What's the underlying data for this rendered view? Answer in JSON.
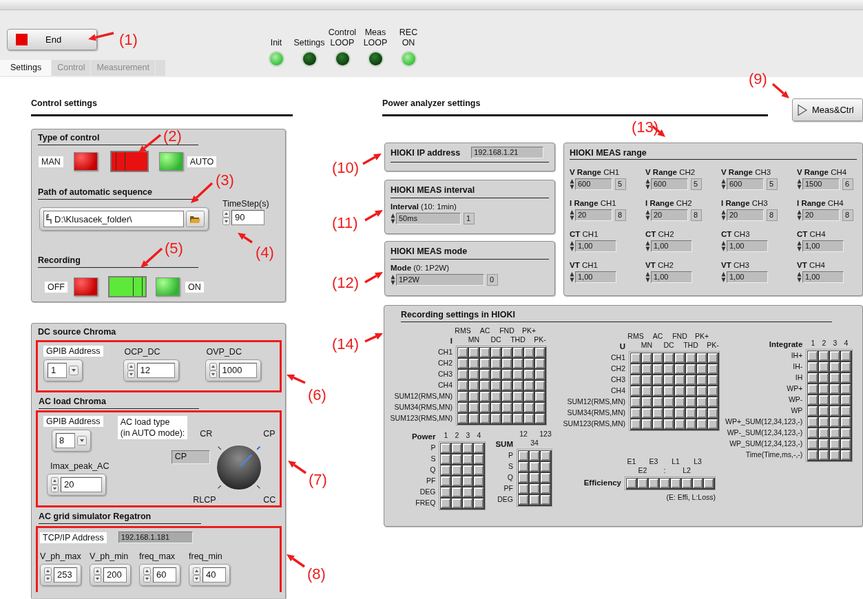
{
  "toolbar": {
    "end_button": "End",
    "leds": [
      {
        "label": "Init",
        "on": true
      },
      {
        "label": "Settings",
        "on": false
      },
      {
        "label": "Control LOOP",
        "on": false
      },
      {
        "label": "Meas LOOP",
        "on": false
      },
      {
        "label": "REC ON",
        "on": true
      }
    ]
  },
  "tabs": [
    {
      "label": "Settings",
      "selected": true
    },
    {
      "label": "Control",
      "selected": false
    },
    {
      "label": "Measurement",
      "selected": false
    }
  ],
  "control_settings": {
    "title": "Control settings",
    "type_of_control": {
      "title": "Type of control",
      "left_label": "MAN",
      "right_label": "AUTO",
      "auto": false
    },
    "path": {
      "title": "Path of automatic sequence",
      "value": "D:\\Klusacek_folder\\"
    },
    "timestep": {
      "label": "TimeStep(s)",
      "value": "90"
    },
    "recording": {
      "title": "Recording",
      "left_label": "OFF",
      "right_label": "ON",
      "on": true
    }
  },
  "dc_source": {
    "title": "DC source Chroma",
    "gpib": {
      "label": "GPIB Address",
      "value": "1"
    },
    "ocp": {
      "label": "OCP_DC",
      "value": "12"
    },
    "ovp": {
      "label": "OVP_DC",
      "value": "1000"
    }
  },
  "ac_load": {
    "title": "AC load Chroma",
    "gpib": {
      "label": "GPIB Address",
      "value": "8"
    },
    "imax": {
      "label": "Imax_peak_AC",
      "value": "20"
    },
    "load_type": {
      "label": "AC load type\n(in AUTO mode):",
      "display": "CP",
      "options": [
        {
          "label": "CR",
          "selected": false
        },
        {
          "label": "CP",
          "selected": true
        },
        {
          "label": "RLCP",
          "selected": false
        },
        {
          "label": "CC",
          "selected": false
        }
      ]
    }
  },
  "ac_grid": {
    "title": "AC grid simulator Regatron",
    "tcpip": {
      "label": "TCP/IP Address",
      "value": "192.168.1.181"
    },
    "fields": [
      {
        "label": "V_ph_max",
        "value": "253"
      },
      {
        "label": "V_ph_min",
        "value": "200"
      },
      {
        "label": "freq_max",
        "value": "60"
      },
      {
        "label": "freq_min",
        "value": "40"
      }
    ]
  },
  "power_analyzer": {
    "title": "Power  analyzer settings",
    "run_button": "Meas&Ctrl",
    "ip": {
      "title": "HIOKI IP address",
      "value": "192.168.1.21"
    },
    "interval": {
      "title": "HIOKI MEAS interval",
      "label": "**Interval** (10: 1min)",
      "value": "50ms",
      "index": "1"
    },
    "mode": {
      "title": "HIOKI MEAS mode",
      "label": "**Mode** (0: 1P2W)",
      "value": "1P2W",
      "index": "0"
    },
    "range": {
      "title": "HIOKI MEAS range",
      "channels": [
        {
          "v": {
            "label": "**V Range** CH1",
            "value": "600",
            "index": "5"
          },
          "i": {
            "label": "**I Range** CH1",
            "value": "20",
            "index": "8"
          },
          "ct": {
            "label": "**CT** CH1",
            "value": "1,00"
          },
          "vt": {
            "label": "**VT** CH1",
            "value": "1,00"
          }
        },
        {
          "v": {
            "label": "**V Range**  CH2",
            "value": "600",
            "index": "5"
          },
          "i": {
            "label": "**I Range** CH2",
            "value": "20",
            "index": "8"
          },
          "ct": {
            "label": "**CT** CH2",
            "value": "1,00"
          },
          "vt": {
            "label": "**VT** CH2",
            "value": "1,00"
          }
        },
        {
          "v": {
            "label": "**V Range**  CH3",
            "value": "600",
            "index": "5"
          },
          "i": {
            "label": "**I Range** CH3",
            "value": "20",
            "index": "8"
          },
          "ct": {
            "label": "**CT** CH3",
            "value": "1,00"
          },
          "vt": {
            "label": "**VT** CH3",
            "value": "1,00"
          }
        },
        {
          "v": {
            "label": "**V Range**  CH4",
            "value": "1500",
            "index": "6"
          },
          "i": {
            "label": "**I Range** CH4",
            "value": "20",
            "index": "8"
          },
          "ct": {
            "label": "**CT** CH4",
            "value": "1,00"
          },
          "vt": {
            "label": "**VT** CH4",
            "value": "1,00"
          }
        }
      ]
    }
  },
  "recording_settings": {
    "title": "Recording settings in HIOKI",
    "i_matrix": {
      "kind": "staggered",
      "label": "I",
      "columns": [
        "RMS",
        "MN",
        "AC",
        "DC",
        "FND",
        "THD",
        "PK+",
        "PK-"
      ],
      "rows": [
        {
          "label": "CH1",
          "checked": [
            false,
            false,
            false,
            false,
            false,
            false,
            false,
            false
          ]
        },
        {
          "label": "CH2",
          "checked": [
            false,
            false,
            false,
            false,
            false,
            false,
            false,
            false
          ]
        },
        {
          "label": "CH3",
          "checked": [
            false,
            false,
            false,
            false,
            false,
            false,
            false,
            false
          ]
        },
        {
          "label": "CH4",
          "checked": [
            false,
            false,
            false,
            false,
            false,
            false,
            false,
            false
          ]
        },
        {
          "label": "SUM12(RMS,MN)",
          "checked": [
            false,
            false,
            false,
            false,
            false,
            false,
            false,
            false
          ]
        },
        {
          "label": "SUM34(RMS,MN)",
          "checked": [
            false,
            false,
            false,
            false,
            false,
            false,
            false,
            false
          ]
        },
        {
          "label": "SUM123(RMS,MN)",
          "checked": [
            false,
            false,
            false,
            false,
            false,
            false,
            false,
            false
          ]
        }
      ]
    },
    "power": {
      "kind": "inline",
      "label": "Power",
      "columns": [
        "1",
        "2",
        "3",
        "4"
      ],
      "rows": [
        {
          "label": "P",
          "checked": [
            false,
            false,
            false,
            false
          ]
        },
        {
          "label": "S",
          "checked": [
            false,
            false,
            false,
            false
          ]
        },
        {
          "label": "Q",
          "checked": [
            false,
            false,
            false,
            false
          ]
        },
        {
          "label": "PF",
          "checked": [
            false,
            false,
            false,
            false
          ]
        },
        {
          "label": "DEG",
          "checked": [
            false,
            false,
            false,
            false
          ]
        },
        {
          "label": "FREQ",
          "checked": [
            false,
            false,
            false,
            false
          ]
        }
      ]
    },
    "sum": {
      "kind": "staggered",
      "label": "SUM",
      "columns": [
        "12",
        "34",
        "123"
      ],
      "rows": [
        {
          "label": "P",
          "checked": [
            false,
            false,
            false
          ]
        },
        {
          "label": "S",
          "checked": [
            false,
            false,
            false
          ]
        },
        {
          "label": "Q",
          "checked": [
            false,
            false,
            false
          ]
        },
        {
          "label": "PF",
          "checked": [
            false,
            false,
            false
          ]
        },
        {
          "label": "DEG",
          "checked": [
            false,
            false,
            false
          ]
        }
      ]
    },
    "u_matrix": {
      "kind": "staggered",
      "label": "U",
      "columns": [
        "RMS",
        "MN",
        "AC",
        "DC",
        "FND",
        "THD",
        "PK+",
        "PK-"
      ],
      "rows": [
        {
          "label": "CH1",
          "checked": [
            false,
            false,
            false,
            false,
            false,
            false,
            false,
            false
          ]
        },
        {
          "label": "CH2",
          "checked": [
            false,
            false,
            false,
            false,
            false,
            false,
            false,
            false
          ]
        },
        {
          "label": "CH3",
          "checked": [
            false,
            false,
            false,
            false,
            false,
            false,
            false,
            false
          ]
        },
        {
          "label": "CH4",
          "checked": [
            false,
            false,
            false,
            false,
            false,
            false,
            false,
            false
          ]
        },
        {
          "label": "SUM12(RMS,MN)",
          "checked": [
            false,
            false,
            false,
            false,
            false,
            false,
            false,
            false
          ]
        },
        {
          "label": "SUM34(RMS,MN)",
          "checked": [
            false,
            false,
            false,
            false,
            false,
            false,
            false,
            false
          ]
        },
        {
          "label": "SUM123(RMS,MN)",
          "checked": [
            false,
            false,
            false,
            false,
            false,
            false,
            false,
            false
          ]
        }
      ]
    },
    "efficiency": {
      "kind": "strip",
      "label": "Efficiency",
      "columns": [
        "E1",
        "E2",
        "E3",
        ":",
        "L1",
        "L2",
        "L3"
      ],
      "checked": [
        false,
        false,
        false,
        false,
        false,
        false,
        false,
        false
      ],
      "note": "(E: Effi, L:Loss)"
    },
    "integrate": {
      "kind": "inline",
      "label": "Integrate",
      "columns": [
        "1",
        "2",
        "3",
        "4"
      ],
      "rows": [
        {
          "label": "IH+",
          "checked": [
            false,
            false,
            false,
            false
          ]
        },
        {
          "label": "IH-",
          "checked": [
            false,
            false,
            false,
            false
          ]
        },
        {
          "label": "IH",
          "checked": [
            false,
            false,
            false,
            false
          ]
        },
        {
          "label": "WP+",
          "checked": [
            false,
            false,
            false,
            false
          ]
        },
        {
          "label": "WP-",
          "checked": [
            false,
            false,
            false,
            false
          ]
        },
        {
          "label": "WP",
          "checked": [
            false,
            false,
            false,
            false
          ]
        },
        {
          "label": "WP+_SUM(12,34,123,-)",
          "checked": [
            false,
            false,
            false,
            false
          ]
        },
        {
          "label": "WP-_SUM(12,34,123,-)",
          "checked": [
            false,
            false,
            false,
            false
          ]
        },
        {
          "label": "WP_SUM(12,34,123,-)",
          "checked": [
            false,
            false,
            false,
            false
          ]
        },
        {
          "label": "Time(Time,ms,-,-)",
          "checked": [
            false,
            false,
            false,
            false
          ]
        }
      ]
    }
  },
  "annotations": [
    "(1)",
    "(2)",
    "(3)",
    "(4)",
    "(5)",
    "(6)",
    "(7)",
    "(8)",
    "(9)",
    "(10)",
    "(11)",
    "(12)",
    "(13)",
    "(14)"
  ]
}
